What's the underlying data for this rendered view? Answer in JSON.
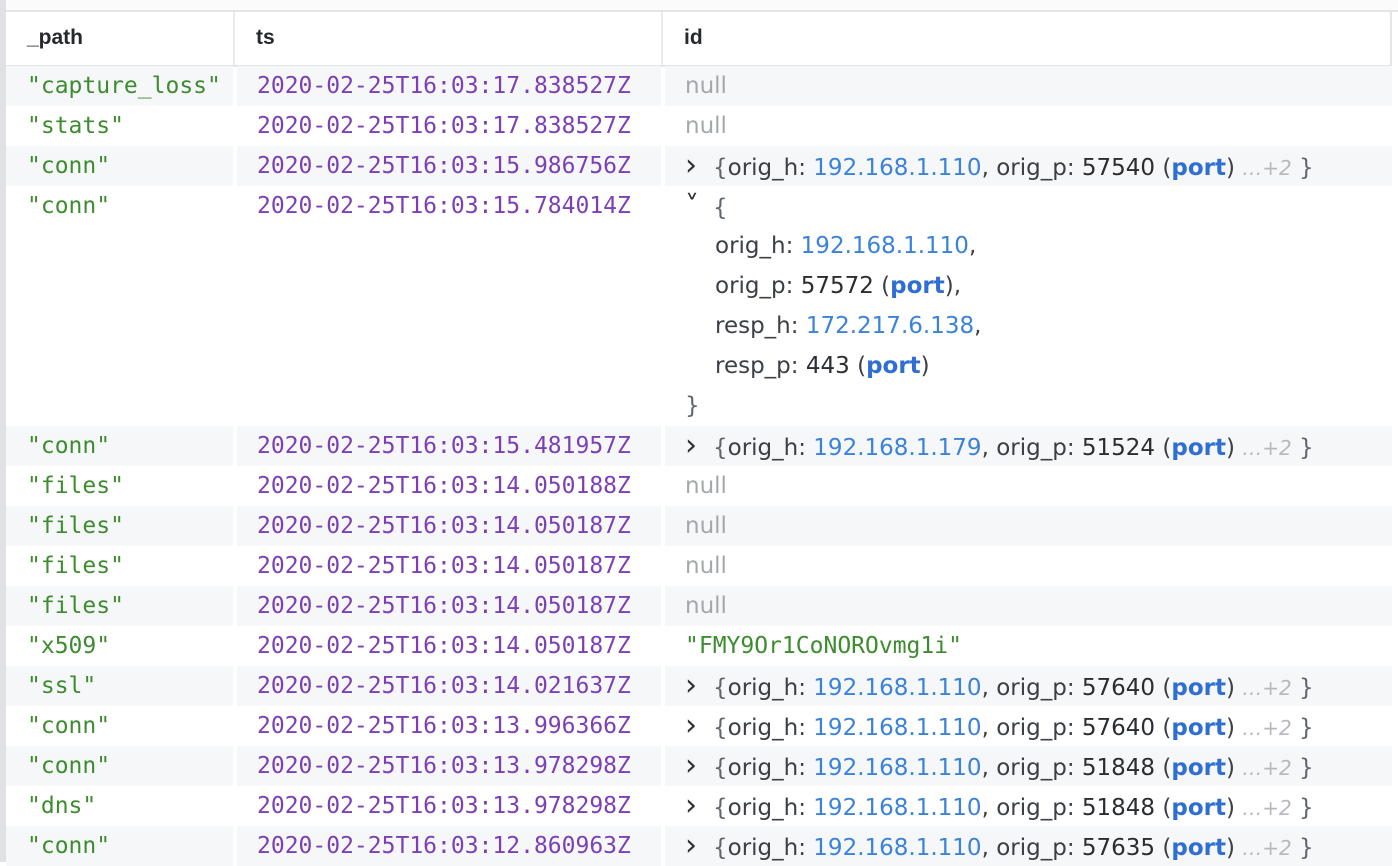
{
  "columns": [
    "_path",
    "ts",
    "id"
  ],
  "rows": [
    {
      "path": "\"capture_loss\"",
      "ts": "2020-02-25T16:03:17.838527Z",
      "id": {
        "kind": "null",
        "text": "null"
      }
    },
    {
      "path": "\"stats\"",
      "ts": "2020-02-25T16:03:17.838527Z",
      "id": {
        "kind": "null",
        "text": "null"
      }
    },
    {
      "path": "\"conn\"",
      "ts": "2020-02-25T16:03:15.986756Z",
      "id": {
        "kind": "collapsed",
        "orig_h": "192.168.1.110",
        "orig_p": "57540",
        "type": "port",
        "more": "…+2"
      }
    },
    {
      "path": "\"conn\"",
      "ts": "2020-02-25T16:03:15.784014Z",
      "id": {
        "kind": "expanded",
        "fields": [
          {
            "key": "orig_h",
            "value": "192.168.1.110",
            "vkind": "ip",
            "sep": ","
          },
          {
            "key": "orig_p",
            "value": "57572",
            "vkind": "port",
            "type": "port",
            "sep": ","
          },
          {
            "key": "resp_h",
            "value": "172.217.6.138",
            "vkind": "ip",
            "sep": ","
          },
          {
            "key": "resp_p",
            "value": "443",
            "vkind": "port",
            "type": "port",
            "sep": ""
          }
        ]
      }
    },
    {
      "path": "\"conn\"",
      "ts": "2020-02-25T16:03:15.481957Z",
      "id": {
        "kind": "collapsed",
        "orig_h": "192.168.1.179",
        "orig_p": "51524",
        "type": "port",
        "more": "…+2"
      }
    },
    {
      "path": "\"files\"",
      "ts": "2020-02-25T16:03:14.050188Z",
      "id": {
        "kind": "null",
        "text": "null"
      }
    },
    {
      "path": "\"files\"",
      "ts": "2020-02-25T16:03:14.050187Z",
      "id": {
        "kind": "null",
        "text": "null"
      }
    },
    {
      "path": "\"files\"",
      "ts": "2020-02-25T16:03:14.050187Z",
      "id": {
        "kind": "null",
        "text": "null"
      }
    },
    {
      "path": "\"files\"",
      "ts": "2020-02-25T16:03:14.050187Z",
      "id": {
        "kind": "null",
        "text": "null"
      }
    },
    {
      "path": "\"x509\"",
      "ts": "2020-02-25T16:03:14.050187Z",
      "id": {
        "kind": "string",
        "text": "\"FMY9Or1CoNOROvmg1i\""
      }
    },
    {
      "path": "\"ssl\"",
      "ts": "2020-02-25T16:03:14.021637Z",
      "id": {
        "kind": "collapsed",
        "orig_h": "192.168.1.110",
        "orig_p": "57640",
        "type": "port",
        "more": "…+2"
      }
    },
    {
      "path": "\"conn\"",
      "ts": "2020-02-25T16:03:13.996366Z",
      "id": {
        "kind": "collapsed",
        "orig_h": "192.168.1.110",
        "orig_p": "57640",
        "type": "port",
        "more": "…+2"
      }
    },
    {
      "path": "\"conn\"",
      "ts": "2020-02-25T16:03:13.978298Z",
      "id": {
        "kind": "collapsed",
        "orig_h": "192.168.1.110",
        "orig_p": "51848",
        "type": "port",
        "more": "…+2"
      }
    },
    {
      "path": "\"dns\"",
      "ts": "2020-02-25T16:03:13.978298Z",
      "id": {
        "kind": "collapsed",
        "orig_h": "192.168.1.110",
        "orig_p": "51848",
        "type": "port",
        "more": "…+2"
      }
    },
    {
      "path": "\"conn\"",
      "ts": "2020-02-25T16:03:12.860963Z",
      "id": {
        "kind": "collapsed",
        "orig_h": "192.168.1.110",
        "orig_p": "57635",
        "type": "port",
        "more": "…+2"
      }
    }
  ],
  "icons": {
    "collapsed": "chevron-right-icon",
    "expanded": "chevron-down-icon"
  },
  "colors": {
    "string": "#3d8c2f",
    "timestamp": "#7c3fb5",
    "null": "#a4a8ad",
    "ip": "#3b82d9",
    "type": "#2f6fd1",
    "stripe": "#f6f7f8"
  }
}
